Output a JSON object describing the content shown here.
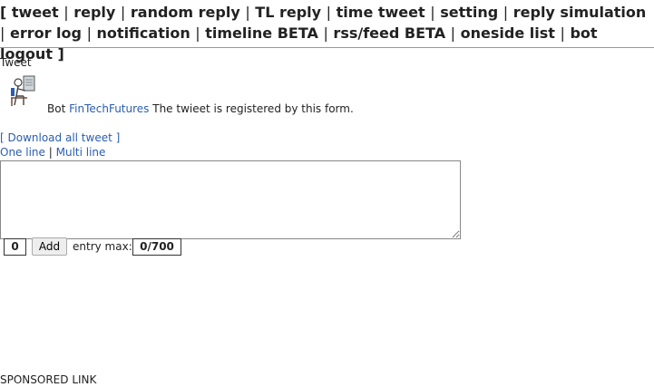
{
  "nav": {
    "open": "[",
    "close": "]",
    "items": [
      "tweet",
      "reply",
      "random reply",
      "TL reply",
      "time tweet",
      "setting",
      "reply simulation",
      "error log",
      "notification",
      "timeline BETA",
      "rss/feed BETA",
      "oneside list",
      "bot logout"
    ]
  },
  "section_title": "Tweet",
  "bot": {
    "prefix": "Bot",
    "name": "FinTechFutures",
    "description": "The twieet is registered by this form."
  },
  "download_link": "[ Download all tweet ]",
  "modes": {
    "one_line": "One line",
    "separator": "|",
    "multi_line": "Multi line"
  },
  "tweet_input": {
    "value": "",
    "placeholder": ""
  },
  "counter": "0",
  "add_label": "Add",
  "entry_label": "entry max:",
  "entry_max": "0/700",
  "sponsored": "SPONSORED LINK"
}
